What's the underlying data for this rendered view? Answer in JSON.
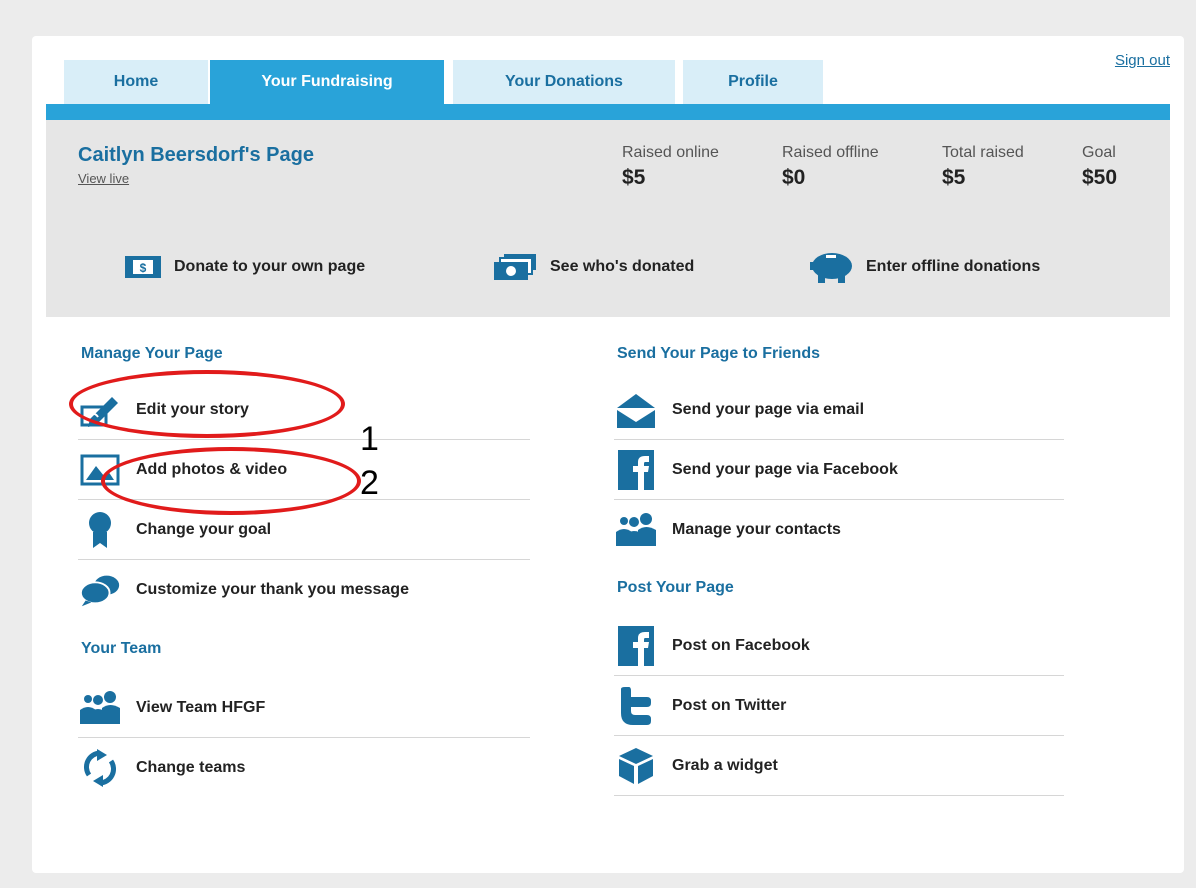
{
  "tabs": [
    {
      "label": "Home"
    },
    {
      "label": "Your Fundraising"
    },
    {
      "label": "Your Donations"
    },
    {
      "label": "Profile"
    }
  ],
  "sign_out": "Sign out",
  "page": {
    "title": "Caitlyn Beersdorf's Page",
    "view_live": "View live"
  },
  "stats": [
    {
      "label": "Raised online",
      "value": "$5"
    },
    {
      "label": "Raised offline",
      "value": "$0"
    },
    {
      "label": "Total raised",
      "value": "$5"
    },
    {
      "label": "Goal",
      "value": "$50"
    }
  ],
  "actions": [
    {
      "label": "Donate to your own page",
      "icon": "dollar-bill-icon"
    },
    {
      "label": "See who's donated",
      "icon": "money-stack-icon"
    },
    {
      "label": "Enter offline donations",
      "icon": "piggy-bank-icon"
    }
  ],
  "manage": {
    "heading": "Manage Your Page",
    "items": [
      {
        "label": "Edit your story",
        "icon": "edit-pen-icon"
      },
      {
        "label": "Add photos & video",
        "icon": "photo-icon"
      },
      {
        "label": "Change your goal",
        "icon": "award-ribbon-icon"
      },
      {
        "label": "Customize your thank you message",
        "icon": "chat-bubbles-icon"
      }
    ]
  },
  "team": {
    "heading": "Your Team",
    "items": [
      {
        "label": "View Team HFGF",
        "icon": "people-group-icon"
      },
      {
        "label": "Change teams",
        "icon": "refresh-icon"
      }
    ]
  },
  "send": {
    "heading": "Send Your Page to Friends",
    "items": [
      {
        "label": "Send your page via email",
        "icon": "envelope-icon"
      },
      {
        "label": "Send your page via Facebook",
        "icon": "facebook-icon"
      },
      {
        "label": "Manage your contacts",
        "icon": "people-group-icon"
      }
    ]
  },
  "post": {
    "heading": "Post Your Page",
    "items": [
      {
        "label": "Post on Facebook",
        "icon": "facebook-icon"
      },
      {
        "label": "Post on Twitter",
        "icon": "twitter-icon"
      },
      {
        "label": "Grab a widget",
        "icon": "cube-icon"
      }
    ]
  },
  "annotations": {
    "one": "1",
    "two": "2"
  },
  "colors": {
    "accent": "#29a3d9",
    "tab_inactive": "#d9eef8",
    "link": "#1a6fa0",
    "annotation": "#e11b1b"
  }
}
